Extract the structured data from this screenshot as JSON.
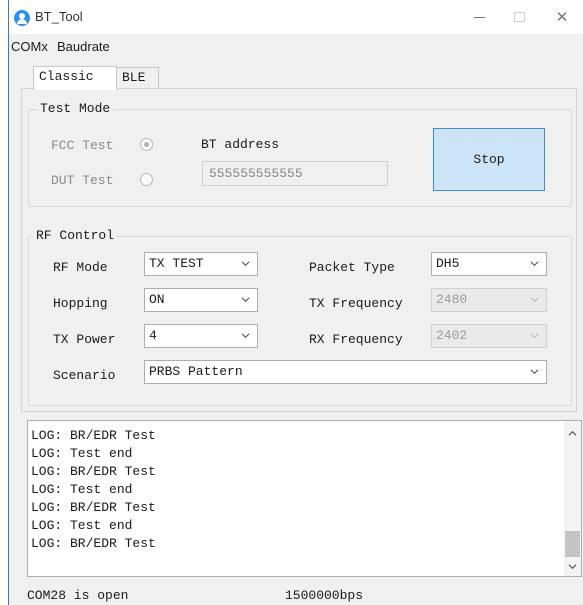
{
  "window": {
    "title": "BT_Tool"
  },
  "menu": {
    "items": [
      "COMx",
      "Baudrate"
    ]
  },
  "tabs": [
    {
      "label": "Classic",
      "active": true
    },
    {
      "label": "BLE",
      "active": false
    }
  ],
  "test_mode": {
    "title": "Test Mode",
    "fcc_label": "FCC Test",
    "fcc_selected": true,
    "dut_label": "DUT Test",
    "dut_selected": false,
    "bt_address_label": "BT address",
    "bt_address_value": "555555555555",
    "stop_label": "Stop"
  },
  "rf_control": {
    "title": "RF Control",
    "rf_mode_label": "RF Mode",
    "rf_mode_value": "TX TEST",
    "packet_type_label": "Packet Type",
    "packet_type_value": "DH5",
    "hopping_label": "Hopping",
    "hopping_value": "ON",
    "tx_frequency_label": "TX Frequency",
    "tx_frequency_value": "2480",
    "tx_power_label": "TX Power",
    "tx_power_value": "4",
    "rx_frequency_label": "RX Frequency",
    "rx_frequency_value": "2402",
    "scenario_label": "Scenario",
    "scenario_value": "PRBS Pattern"
  },
  "log": {
    "lines": [
      "LOG: BR/EDR Test",
      "LOG: Test end",
      "LOG: BR/EDR Test",
      "LOG: Test end",
      "LOG: BR/EDR Test",
      "LOG: Test end",
      "LOG: BR/EDR Test"
    ]
  },
  "status": {
    "port": "COM28 is open",
    "baudrate": "1500000bps"
  },
  "colors": {
    "accent": "#3d8ed8",
    "button_fill": "#cde4f7",
    "window_bg": "#f0f0f0"
  }
}
